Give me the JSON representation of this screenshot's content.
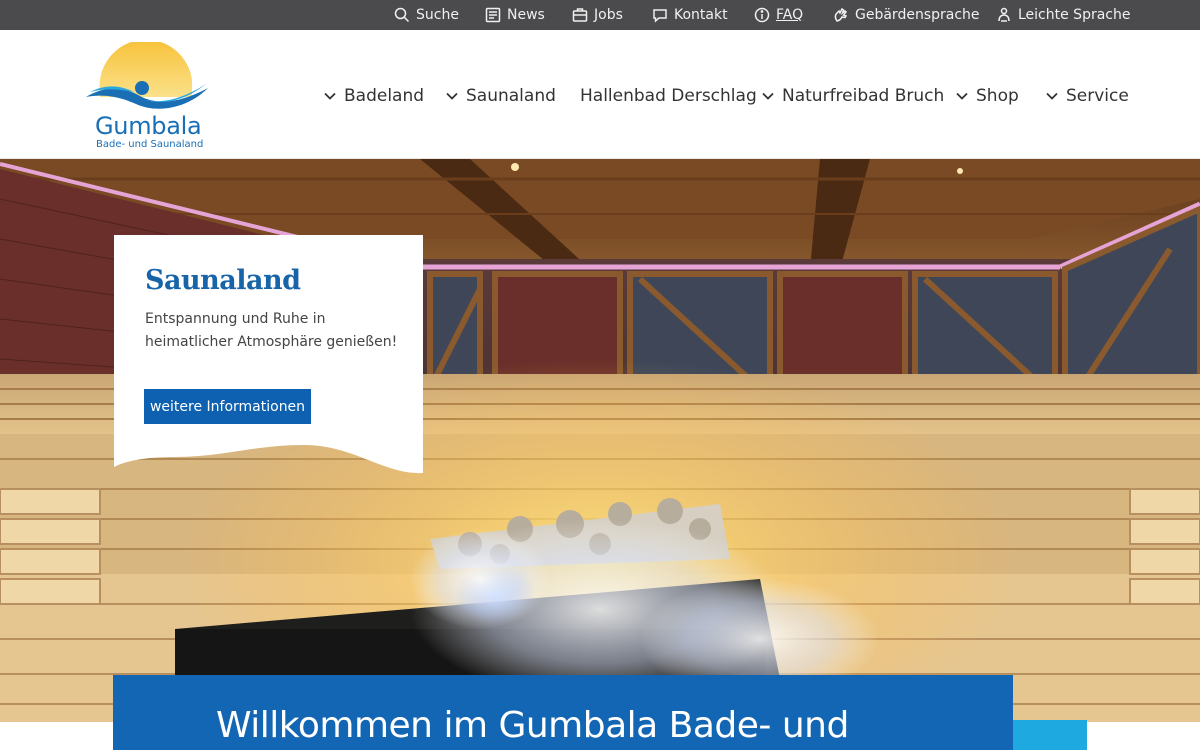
{
  "utility_nav": [
    {
      "label": "Suche",
      "icon": "search-icon"
    },
    {
      "label": "News",
      "icon": "news-icon"
    },
    {
      "label": "Jobs",
      "icon": "jobs-icon"
    },
    {
      "label": "Kontakt",
      "icon": "chat-icon"
    },
    {
      "label": "FAQ",
      "icon": "info-icon"
    },
    {
      "label": "Gebärdensprache",
      "icon": "sign-language-icon"
    },
    {
      "label": "Leichte Sprache",
      "icon": "easy-language-icon"
    }
  ],
  "logo": {
    "brand": "Gumbala",
    "tagline": "Bade- und Saunaland"
  },
  "main_nav": [
    {
      "label": "Badeland",
      "dropdown": true
    },
    {
      "label": "Saunaland",
      "dropdown": true
    },
    {
      "label": "Hallenbad Derschlag",
      "dropdown": false
    },
    {
      "label": "Naturfreibad Bruch",
      "dropdown": true
    },
    {
      "label": "Shop",
      "dropdown": true
    },
    {
      "label": "Service",
      "dropdown": true
    }
  ],
  "teaser": {
    "title": "Saunaland",
    "text": "Entspannung und Ruhe in heimatlicher Atmosphäre genießen!",
    "button": "weitere Informationen"
  },
  "welcome": {
    "heading": "Willkommen im Gumbala Bade- und"
  },
  "colors": {
    "primary_blue": "#1366b3",
    "accent_cyan": "#1ea9e1",
    "topbar": "#4b4b4d"
  }
}
